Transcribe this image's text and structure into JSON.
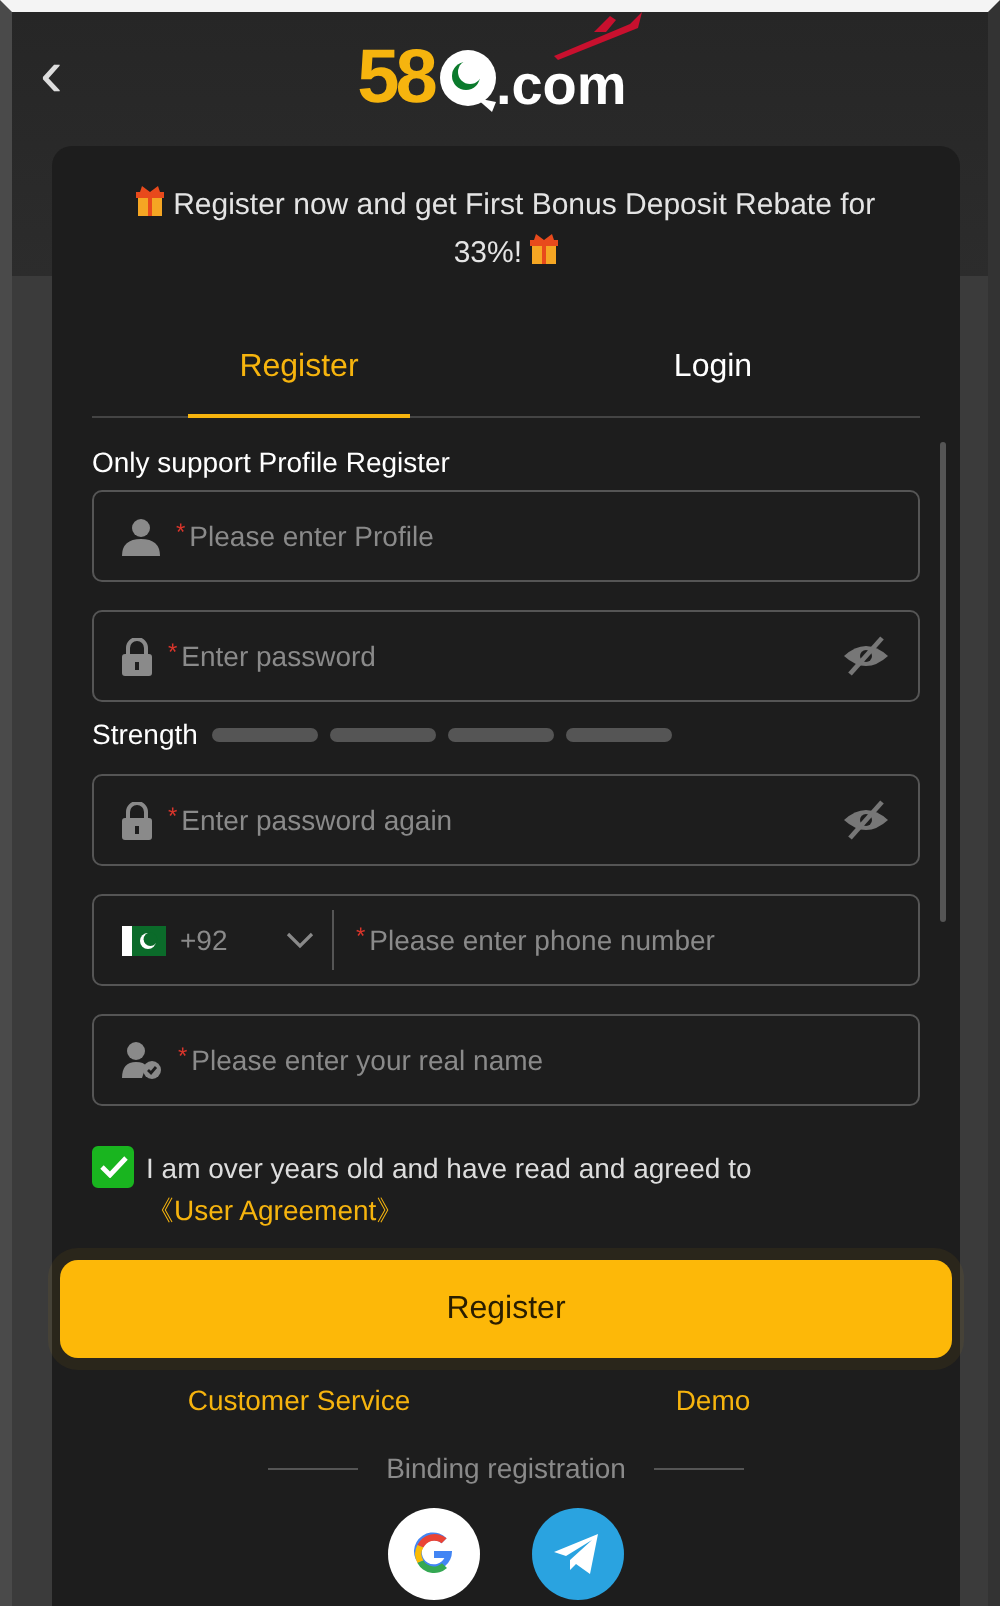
{
  "header": {
    "back": "‹",
    "logo": {
      "number": "58",
      "domain": ".com"
    }
  },
  "banner": {
    "text": "Register now and get First Bonus Deposit Rebate for 33%!"
  },
  "tabs": [
    {
      "label": "Register",
      "selected": true
    },
    {
      "label": "Login",
      "selected": false
    }
  ],
  "form": {
    "note": "Only support Profile Register",
    "fields": [
      {
        "kind": "profile",
        "mark": "*",
        "placeholder": "Please enter Profile"
      },
      {
        "kind": "password",
        "mark": "*",
        "placeholder": "Enter password",
        "visible": false
      },
      {
        "kind": "strength",
        "label": "Strength"
      },
      {
        "kind": "password",
        "mark": "*",
        "placeholder": "Enter password again",
        "visible": false
      },
      {
        "kind": "phone",
        "code": "+92",
        "mark": "*",
        "placeholder": "Please enter phone number"
      },
      {
        "kind": "realname",
        "mark": "*",
        "placeholder": "Please enter your real name"
      }
    ],
    "agreement": {
      "checked": true,
      "text": "I am over years old and have read and agreed to",
      "link": "《User Agreement》"
    },
    "submit": "Register"
  },
  "links": [
    "Customer Service",
    "Demo"
  ],
  "binding": {
    "label": "Binding registration",
    "providers": [
      {
        "kind": "google"
      },
      {
        "kind": "telegram"
      }
    ]
  }
}
